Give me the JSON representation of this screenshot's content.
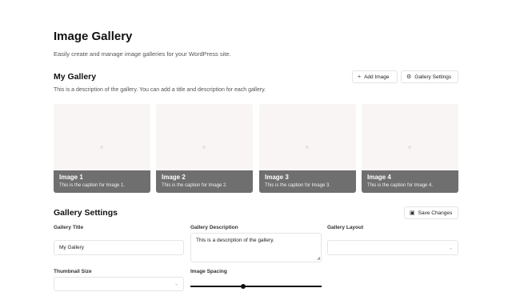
{
  "header": {
    "title": "Image Gallery",
    "subtitle": "Easily create and manage image galleries for your WordPress site."
  },
  "gallery": {
    "name": "My Gallery",
    "description": "This is a description of the gallery. You can add a title and description for each gallery.",
    "add_image_label": "Add Image",
    "add_image_icon": "plus-icon",
    "settings_label": "Gallery Settings",
    "settings_icon": "gear-icon",
    "images": [
      {
        "title": "Image 1",
        "caption": "This is the caption for Image 1."
      },
      {
        "title": "Image 2",
        "caption": "This is the caption for Image 2."
      },
      {
        "title": "Image 3",
        "caption": "This is the caption for Image 3."
      },
      {
        "title": "Image 4",
        "caption": "This is the caption for Image 4."
      }
    ]
  },
  "settings": {
    "title": "Gallery Settings",
    "save_label": "Save Changes",
    "save_icon": "save-icon",
    "gallery_title_label": "Gallery Title",
    "gallery_title_value": "My Gallery",
    "gallery_description_label": "Gallery Description",
    "gallery_description_value": "This is a description of the gallery.",
    "gallery_layout_label": "Gallery Layout",
    "gallery_layout_value": "",
    "thumbnail_size_label": "Thumbnail Size",
    "thumbnail_size_value": "",
    "image_spacing_label": "Image Spacing",
    "image_spacing_fraction": 0.4
  }
}
